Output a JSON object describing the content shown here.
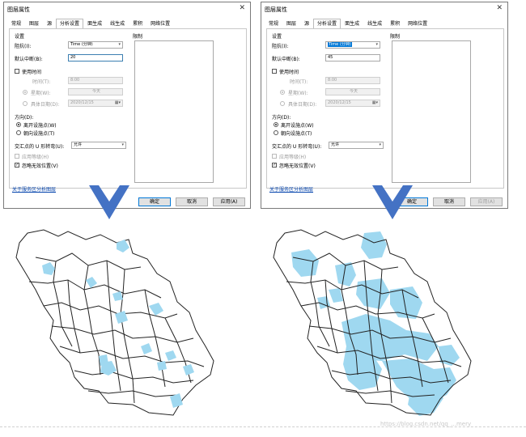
{
  "dialogs": [
    {
      "title": "图层属性",
      "close": "✕",
      "tabs": [
        "常规",
        "图层",
        "源",
        "分析设置",
        "面生成",
        "线生成",
        "累积",
        "网络位置"
      ],
      "active_tab": "分析设置",
      "settings_header": "设置",
      "impedance_label": "阻抗(I):",
      "impedance_value": "Time (分钟)",
      "breaks_label": "默认中断(B):",
      "breaks_value": "20",
      "use_time_label": "使用时间",
      "time_label": "时间(T):",
      "time_value": "8:00",
      "weekday_label": "星期(W):",
      "weekday_value": "今天",
      "date_label": "具体日期(D):",
      "date_value": "2020/12/15",
      "direction_label": "方向(D):",
      "dir_away": "离开设施点(W)",
      "dir_toward": "朝向设施点(T)",
      "uturn_label": "交汇点的 U 形转弯(U):",
      "uturn_value": "允许",
      "hierarchy_label": "应用等级(H)",
      "ignore_label": "忽略无效位置(V)",
      "restrictions_label": "限制",
      "link": "关于服务区分析图层",
      "ok": "确定",
      "cancel": "取消",
      "apply": "应用(A)"
    },
    {
      "title": "图层属性",
      "close": "✕",
      "tabs": [
        "常规",
        "图层",
        "源",
        "分析设置",
        "面生成",
        "线生成",
        "累积",
        "网络位置"
      ],
      "active_tab": "分析设置",
      "settings_header": "设置",
      "impedance_label": "阻抗(I):",
      "impedance_value": "Time (分钟)",
      "breaks_label": "默认中断(B):",
      "breaks_value": "45",
      "use_time_label": "使用时间",
      "time_label": "时间(T):",
      "time_value": "8:00",
      "weekday_label": "星期(W):",
      "weekday_value": "今天",
      "date_label": "具体日期(D):",
      "date_value": "2020/12/15",
      "direction_label": "方向(D):",
      "dir_away": "离开设施点(W)",
      "dir_toward": "朝向设施点(T)",
      "uturn_label": "交汇点的 U 形转弯(U):",
      "uturn_value": "允许",
      "hierarchy_label": "应用等级(H)",
      "ignore_label": "忽略无效位置(V)",
      "restrictions_label": "限制",
      "link": "关于服务区分析图层",
      "ok": "确定",
      "cancel": "取消",
      "apply": "应用(A)"
    }
  ],
  "colors": {
    "arrow": "#4472c4",
    "coverage": "#9fd8f0",
    "boundary": "#222222",
    "accent": "#0078d7"
  },
  "watermark": "https://blog.csdn.net/qq_...mery"
}
